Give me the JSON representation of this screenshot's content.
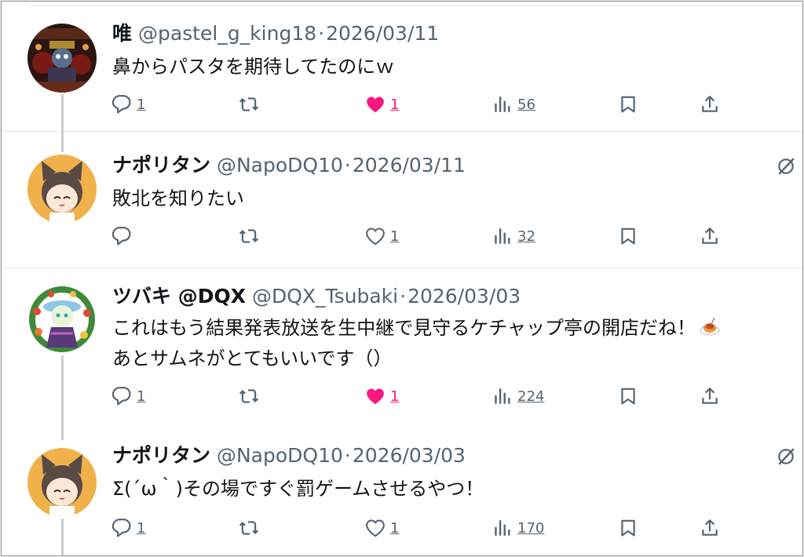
{
  "tweets": [
    {
      "name": "唯",
      "handle": "@pastel_g_king18",
      "separator": "·",
      "date": "2026/03/11",
      "text": "鼻からパスタを期待してたのにｗ",
      "replies": "1",
      "likes": "1",
      "liked": true,
      "views": "56",
      "avatar_icon": "dark-character-avatar",
      "show_more_icon": false
    },
    {
      "name": "ナポリタン",
      "handle": "@NapoDQ10",
      "separator": "·",
      "date": "2026/03/11",
      "text": "敗北を知りたい",
      "replies": "",
      "likes": "1",
      "liked": false,
      "views": "32",
      "avatar_icon": "cat-ear-character-avatar",
      "show_more_icon": true
    },
    {
      "name": "ツバキ @DQX",
      "handle": "@DQX_Tsubaki",
      "separator": "·",
      "date": "2026/03/03",
      "text_line1": "これはもう結果発表放送を生中継で見守るケチャップ亭の開店だね！",
      "text_line2": "あとサムネがとてもいいです（）",
      "emoji": "spaghetti-emoji",
      "replies": "1",
      "likes": "1",
      "liked": true,
      "views": "224",
      "avatar_icon": "flower-wreath-character-avatar",
      "show_more_icon": false
    },
    {
      "name": "ナポリタン",
      "handle": "@NapoDQ10",
      "separator": "·",
      "date": "2026/03/03",
      "text": "Σ(´ω｀)その場ですぐ罰ゲームさせるやつ！",
      "replies": "1",
      "likes": "1",
      "liked": false,
      "views": "170",
      "avatar_icon": "cat-ear-character-avatar",
      "show_more_icon": true
    }
  ],
  "colors": {
    "text": "#0f1419",
    "secondary": "#536471",
    "like_active": "#f91880",
    "divider": "#e3e6e8",
    "thread_line": "#c9ced2"
  },
  "icons": [
    "reply-icon",
    "retweet-icon",
    "like-icon",
    "views-icon",
    "bookmark-icon",
    "share-icon",
    "grok-icon"
  ]
}
